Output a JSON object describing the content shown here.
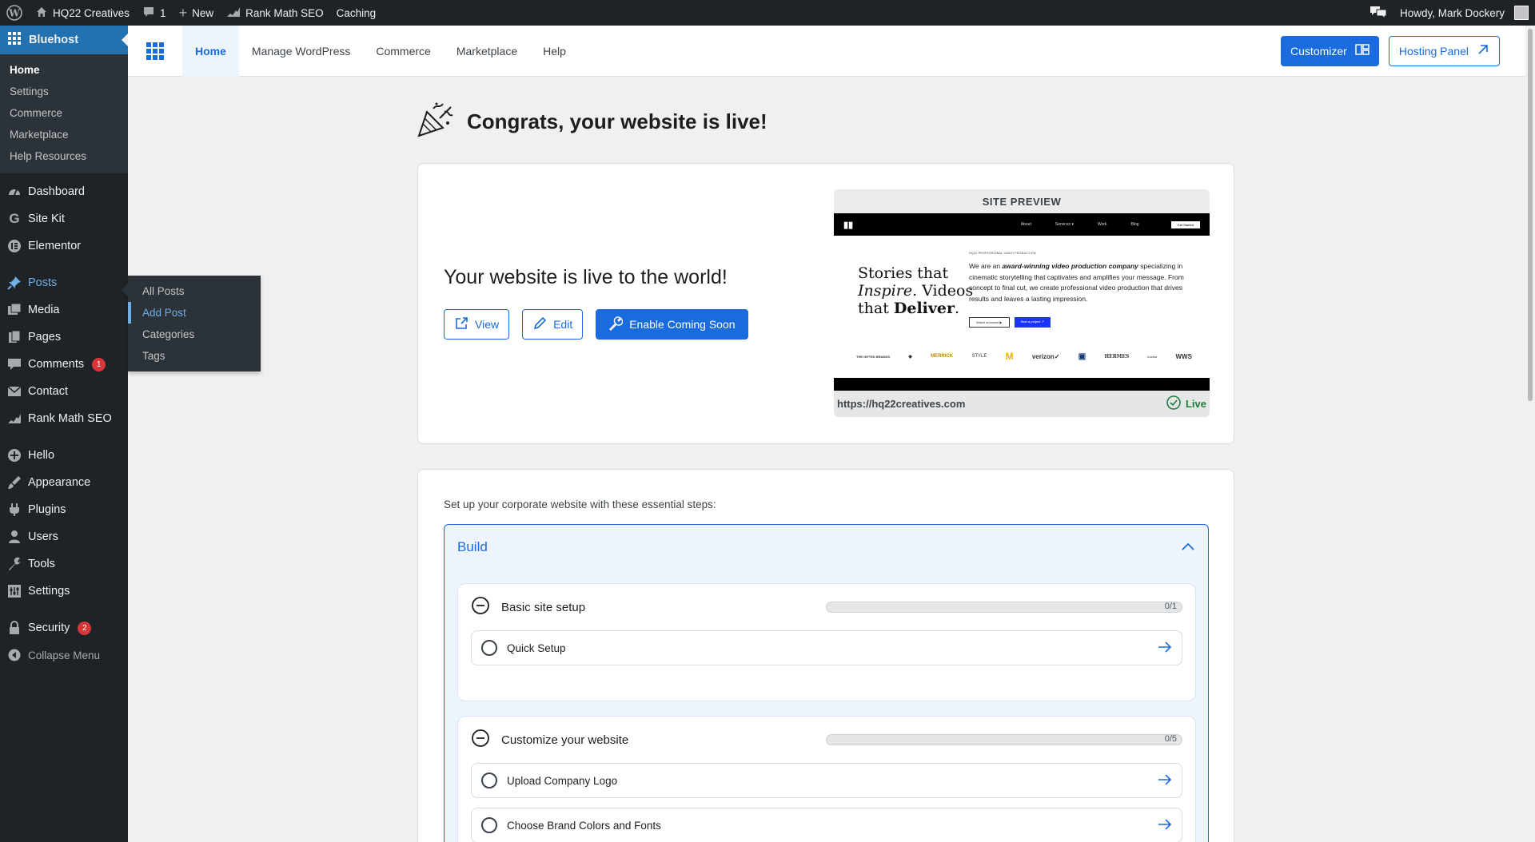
{
  "adminbar": {
    "site_name": "HQ22 Creatives",
    "comments_count": "1",
    "new_label": "New",
    "rankmath_label": "Rank Math SEO",
    "caching_label": "Caching",
    "howdy": "Howdy, Mark Dockery"
  },
  "sidebar": {
    "brand": "Bluehost",
    "brand_sub": [
      "Home",
      "Settings",
      "Commerce",
      "Marketplace",
      "Help Resources"
    ],
    "items": {
      "dashboard": "Dashboard",
      "sitekit": "Site Kit",
      "elementor": "Elementor",
      "posts": "Posts",
      "media": "Media",
      "pages": "Pages",
      "comments": "Comments",
      "comments_badge": "1",
      "contact": "Contact",
      "rankmath": "Rank Math SEO",
      "hello": "Hello",
      "appearance": "Appearance",
      "plugins": "Plugins",
      "users": "Users",
      "tools": "Tools",
      "settings": "Settings",
      "security": "Security",
      "security_badge": "2",
      "collapse": "Collapse Menu"
    },
    "flyout": [
      "All Posts",
      "Add Post",
      "Categories",
      "Tags"
    ]
  },
  "topnav": {
    "tabs": [
      "Home",
      "Manage WordPress",
      "Commerce",
      "Marketplace",
      "Help"
    ],
    "customizer": "Customizer",
    "hosting_panel": "Hosting Panel"
  },
  "main": {
    "congrats": "Congrats, your website is live!",
    "live_title": "Your website is live to the world!",
    "view": "View",
    "edit": "Edit",
    "coming_soon": "Enable Coming Soon",
    "preview": {
      "header": "SITE PREVIEW",
      "url": "https://hq22creatives.com",
      "status": "Live",
      "nav_links": [
        "About",
        "Services ▾",
        "Work",
        "Blog"
      ],
      "nav_cta": "Get Started",
      "tagline": "HQ22 PROFESSIONAL VIDEO PRODUCTION",
      "hero_line1": "Stories that",
      "hero_line2a": "Inspire",
      "hero_line2b": ". Videos",
      "hero_line3a": "that ",
      "hero_line3b": "Deliver",
      "hero_line3c": ".",
      "body_a": "We are an ",
      "body_b": "award-winning video production company",
      "body_c": " specializing in cinematic storytelling that captivates and amplifies your message. From concept to final cut, we create professional video production that drives results and leaves a lasting impression.",
      "btn1": "Watch showreel ▶",
      "btn2": "Start a project ↗",
      "logos": [
        "THE GIFTED BRANDS",
        "◆",
        "MERRICK",
        "STYLE",
        "M",
        "verizon✓",
        "▣",
        "HERMES",
        "lumina",
        "WWS"
      ]
    },
    "setup_intro": "Set up your corporate website with these essential steps:",
    "build_label": "Build",
    "group1": {
      "title": "Basic site setup",
      "progress": "0/1",
      "tasks": [
        "Quick Setup"
      ]
    },
    "group2": {
      "title": "Customize your website",
      "progress": "0/5",
      "tasks": [
        "Upload Company Logo",
        "Choose Brand Colors and Fonts"
      ]
    }
  }
}
